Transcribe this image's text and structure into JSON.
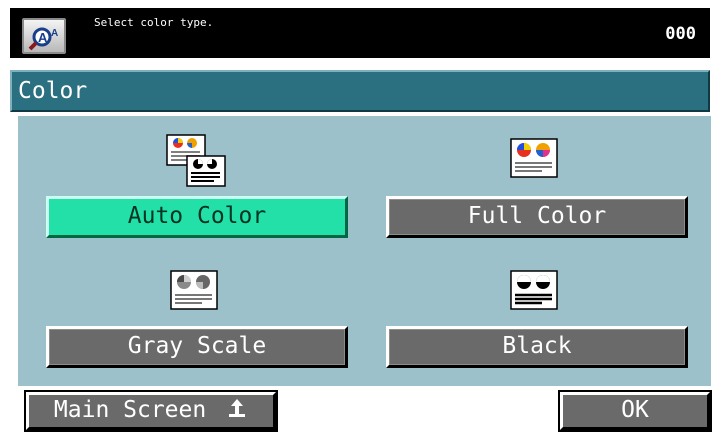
{
  "header": {
    "instruction": "Select color type.",
    "counter": "000",
    "zoom_icon": "magnify-text-icon"
  },
  "title": "Color",
  "options": [
    {
      "label": "Auto Color",
      "selected": true,
      "icon": "auto-color-icon"
    },
    {
      "label": "Full Color",
      "selected": false,
      "icon": "full-color-icon"
    },
    {
      "label": "Gray Scale",
      "selected": false,
      "icon": "gray-scale-icon"
    },
    {
      "label": "Black",
      "selected": false,
      "icon": "black-icon"
    }
  ],
  "footer": {
    "main_screen_label": "Main Screen",
    "ok_label": "OK"
  },
  "colors": {
    "title_bar": "#2a7080",
    "panel": "#9dc1ca",
    "selected": "#22e0a8",
    "button": "#6a6a6a"
  }
}
